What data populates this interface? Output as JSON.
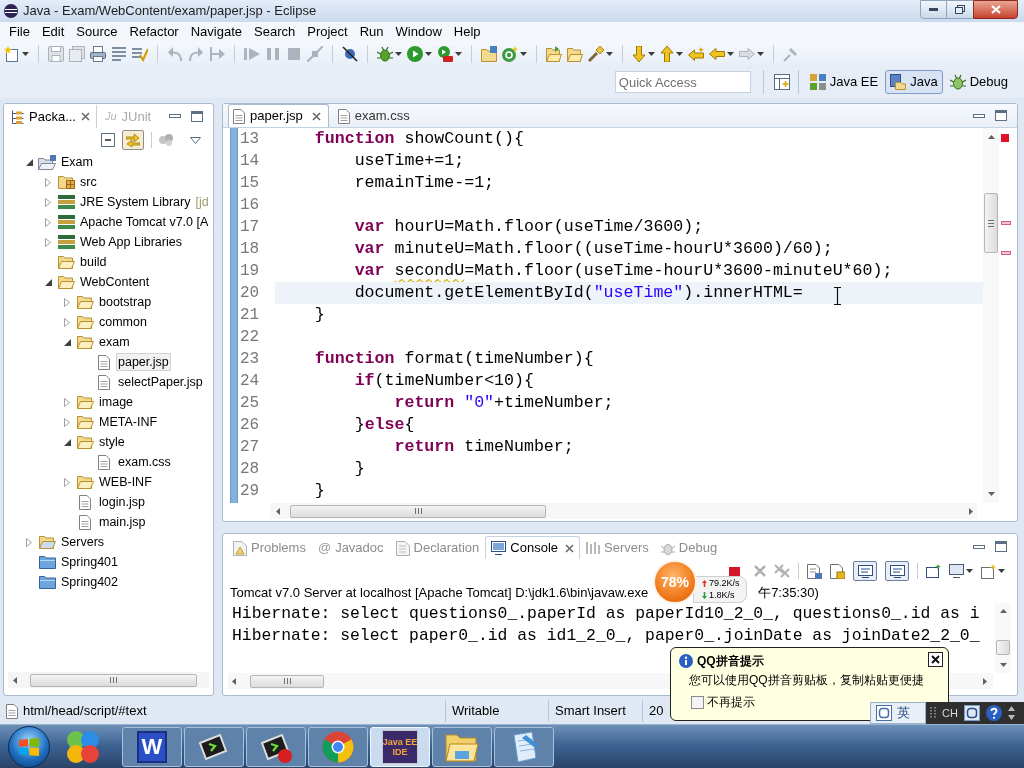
{
  "window": {
    "title": "Java - Exam/WebContent/exam/paper.jsp - Eclipse"
  },
  "menu": [
    "File",
    "Edit",
    "Source",
    "Refactor",
    "Navigate",
    "Search",
    "Project",
    "Run",
    "Window",
    "Help"
  ],
  "quick_access": {
    "placeholder": "Quick Access"
  },
  "perspectives": [
    {
      "label": "Java EE",
      "selected": false
    },
    {
      "label": "Java",
      "selected": true
    },
    {
      "label": "Debug",
      "selected": false
    }
  ],
  "package_explorer": {
    "tabs": [
      {
        "label": "Packa...",
        "selected": true
      },
      {
        "glyph": "Ju",
        "label": "JUnit",
        "selected": false
      }
    ],
    "toolbar_toggles": [
      {
        "pressed": true
      }
    ],
    "tree": [
      {
        "label": "Exam",
        "kind": "project",
        "expanded": true,
        "selected": false,
        "children": [
          {
            "label": "src",
            "kind": "source-folder",
            "expanded": false,
            "selected": false
          },
          {
            "label": "JRE System Library",
            "decoration": "[jd",
            "kind": "library",
            "expanded": false,
            "selected": false
          },
          {
            "label": "Apache Tomcat v7.0 [A",
            "kind": "library",
            "expanded": false,
            "selected": false
          },
          {
            "label": "Web App Libraries",
            "kind": "library",
            "expanded": false,
            "selected": false
          },
          {
            "label": "build",
            "kind": "folder",
            "selected": false
          },
          {
            "label": "WebContent",
            "kind": "folder",
            "expanded": true,
            "selected": false,
            "children": [
              {
                "label": "bootstrap",
                "kind": "folder",
                "expanded": false,
                "selected": false
              },
              {
                "label": "common",
                "kind": "folder",
                "expanded": false,
                "selected": false
              },
              {
                "label": "exam",
                "kind": "folder",
                "expanded": true,
                "selected": false,
                "children": [
                  {
                    "label": "paper.jsp",
                    "kind": "file",
                    "selected": true
                  },
                  {
                    "label": "selectPaper.jsp",
                    "kind": "file",
                    "selected": false
                  }
                ]
              },
              {
                "label": "image",
                "kind": "folder",
                "expanded": false,
                "selected": false
              },
              {
                "label": "META-INF",
                "kind": "folder",
                "expanded": false,
                "selected": false
              },
              {
                "label": "style",
                "kind": "folder",
                "expanded": true,
                "selected": false,
                "children": [
                  {
                    "label": "exam.css",
                    "kind": "file",
                    "selected": false
                  }
                ]
              },
              {
                "label": "WEB-INF",
                "kind": "folder",
                "expanded": false,
                "selected": false
              },
              {
                "label": "login.jsp",
                "kind": "file",
                "selected": false
              },
              {
                "label": "main.jsp",
                "kind": "file",
                "selected": false
              }
            ]
          }
        ]
      },
      {
        "label": "Servers",
        "kind": "servers-folder",
        "expanded": false,
        "selected": false
      },
      {
        "label": "Spring401",
        "kind": "closed-project",
        "selected": false
      },
      {
        "label": "Spring402",
        "kind": "closed-project",
        "selected": false
      }
    ]
  },
  "editor": {
    "tabs": [
      {
        "label": "paper.jsp",
        "selected": true
      },
      {
        "label": "exam.css",
        "selected": false
      }
    ],
    "lines": [
      {
        "number": "13",
        "current": false,
        "tokens": [
          {
            "text": "    function",
            "kind": "keyword"
          },
          {
            "text": " showCount(){",
            "kind": "plain"
          }
        ]
      },
      {
        "number": "14",
        "current": false,
        "tokens": [
          {
            "text": "        useTime+=1;",
            "kind": "plain"
          }
        ]
      },
      {
        "number": "15",
        "current": false,
        "tokens": [
          {
            "text": "        remainTime-=1;",
            "kind": "plain"
          }
        ]
      },
      {
        "number": "16",
        "current": false
      },
      {
        "number": "17",
        "current": false,
        "tokens": [
          {
            "text": "        var",
            "kind": "keyword"
          },
          {
            "text": " hourU=Math.floor(useTime/3600);",
            "kind": "plain"
          }
        ]
      },
      {
        "number": "18",
        "current": false,
        "tokens": [
          {
            "text": "        var",
            "kind": "keyword"
          },
          {
            "text": " minuteU=Math.floor((useTime-hourU*3600)/60);",
            "kind": "plain"
          }
        ]
      },
      {
        "number": "19",
        "current": false,
        "tokens": [
          {
            "text": "        var ",
            "kind": "keyword"
          },
          {
            "text": "secondU",
            "kind": "warning"
          },
          {
            "text": "=Math.floor(useTime-hourU*3600-minuteU*60);",
            "kind": "plain"
          }
        ]
      },
      {
        "number": "20",
        "current": true,
        "tokens": [
          {
            "text": "        document.getElementById(",
            "kind": "plain"
          },
          {
            "text": "\"useTime\"",
            "kind": "string"
          },
          {
            "text": ").innerHTML=",
            "kind": "plain"
          }
        ]
      },
      {
        "number": "21",
        "current": false,
        "tokens": [
          {
            "text": "    }",
            "kind": "plain"
          }
        ]
      },
      {
        "number": "22",
        "current": false
      },
      {
        "number": "23",
        "current": false,
        "tokens": [
          {
            "text": "    function",
            "kind": "keyword"
          },
          {
            "text": " format(timeNumber){",
            "kind": "plain"
          }
        ]
      },
      {
        "number": "24",
        "current": false,
        "tokens": [
          {
            "text": "        if",
            "kind": "keyword"
          },
          {
            "text": "(timeNumber<10){",
            "kind": "plain"
          }
        ]
      },
      {
        "number": "25",
        "current": false,
        "tokens": [
          {
            "text": "            return ",
            "kind": "keyword"
          },
          {
            "text": "\"0\"",
            "kind": "string"
          },
          {
            "text": "+timeNumber;",
            "kind": "plain"
          }
        ]
      },
      {
        "number": "26",
        "current": false,
        "tokens": [
          {
            "text": "        }",
            "kind": "plain"
          },
          {
            "text": "else",
            "kind": "keyword"
          },
          {
            "text": "{",
            "kind": "plain"
          }
        ]
      },
      {
        "number": "27",
        "current": false,
        "tokens": [
          {
            "text": "            return",
            "kind": "keyword"
          },
          {
            "text": " timeNumber;",
            "kind": "plain"
          }
        ]
      },
      {
        "number": "28",
        "current": false,
        "tokens": [
          {
            "text": "        }",
            "kind": "plain"
          }
        ]
      },
      {
        "number": "29",
        "current": false,
        "tokens": [
          {
            "text": "    }",
            "kind": "plain"
          }
        ]
      }
    ]
  },
  "bottom_panel": {
    "tabs": [
      {
        "label": "Problems",
        "selected": false
      },
      {
        "glyph": "@",
        "label": "Javadoc",
        "selected": false
      },
      {
        "label": "Declaration",
        "selected": false
      },
      {
        "label": "Console",
        "selected": true
      },
      {
        "label": "Servers",
        "selected": false
      },
      {
        "label": "Debug",
        "selected": false
      }
    ],
    "toolbar_toggles": [
      {
        "pressed": true
      },
      {
        "pressed": true
      }
    ],
    "console": {
      "description": "Tomcat v7.0 Server at localhost [Apache Tomcat] D:\\jdk1.6\\bin\\javaw.exe",
      "description_tail": "午7:35:30)",
      "lines": [
        "Hibernate: select questions0_.paperId as paperId10_2_0_, questions0_.id as i",
        "Hibernate: select paper0_.id as id1_2_0_, paper0_.joinDate as joinDate2_2_0_"
      ]
    }
  },
  "status_bar": {
    "path": "html/head/script/#text",
    "fields": [
      "Writable",
      "Smart Insert",
      "20"
    ]
  },
  "net_monitor": {
    "percent": "78%",
    "upload": "79.2K/s",
    "download": "1.8K/s"
  },
  "qq_popup": {
    "title": "QQ拼音提示",
    "message": "您可以使用QQ拼音剪贴板，复制粘贴更便捷",
    "checkbox": {
      "label": "不再提示",
      "checked": false
    }
  },
  "ime_bar": {
    "mode": "英",
    "language": "CH"
  },
  "taskbar": {
    "apps": [
      {
        "kind": "launcher",
        "running": false,
        "selected": false
      },
      {
        "kind": "writer",
        "logo_text": "W",
        "running": true,
        "selected": false
      },
      {
        "kind": "terminal",
        "running": true,
        "selected": false
      },
      {
        "kind": "terminal-alert",
        "running": true,
        "selected": false
      },
      {
        "kind": "browser",
        "running": true,
        "selected": false
      },
      {
        "kind": "ide",
        "logo_lines": [
          "Java EE",
          "IDE"
        ],
        "running": true,
        "selected": true
      },
      {
        "kind": "explorer",
        "running": true,
        "selected": false
      },
      {
        "kind": "notepad",
        "running": true,
        "selected": false
      }
    ]
  }
}
